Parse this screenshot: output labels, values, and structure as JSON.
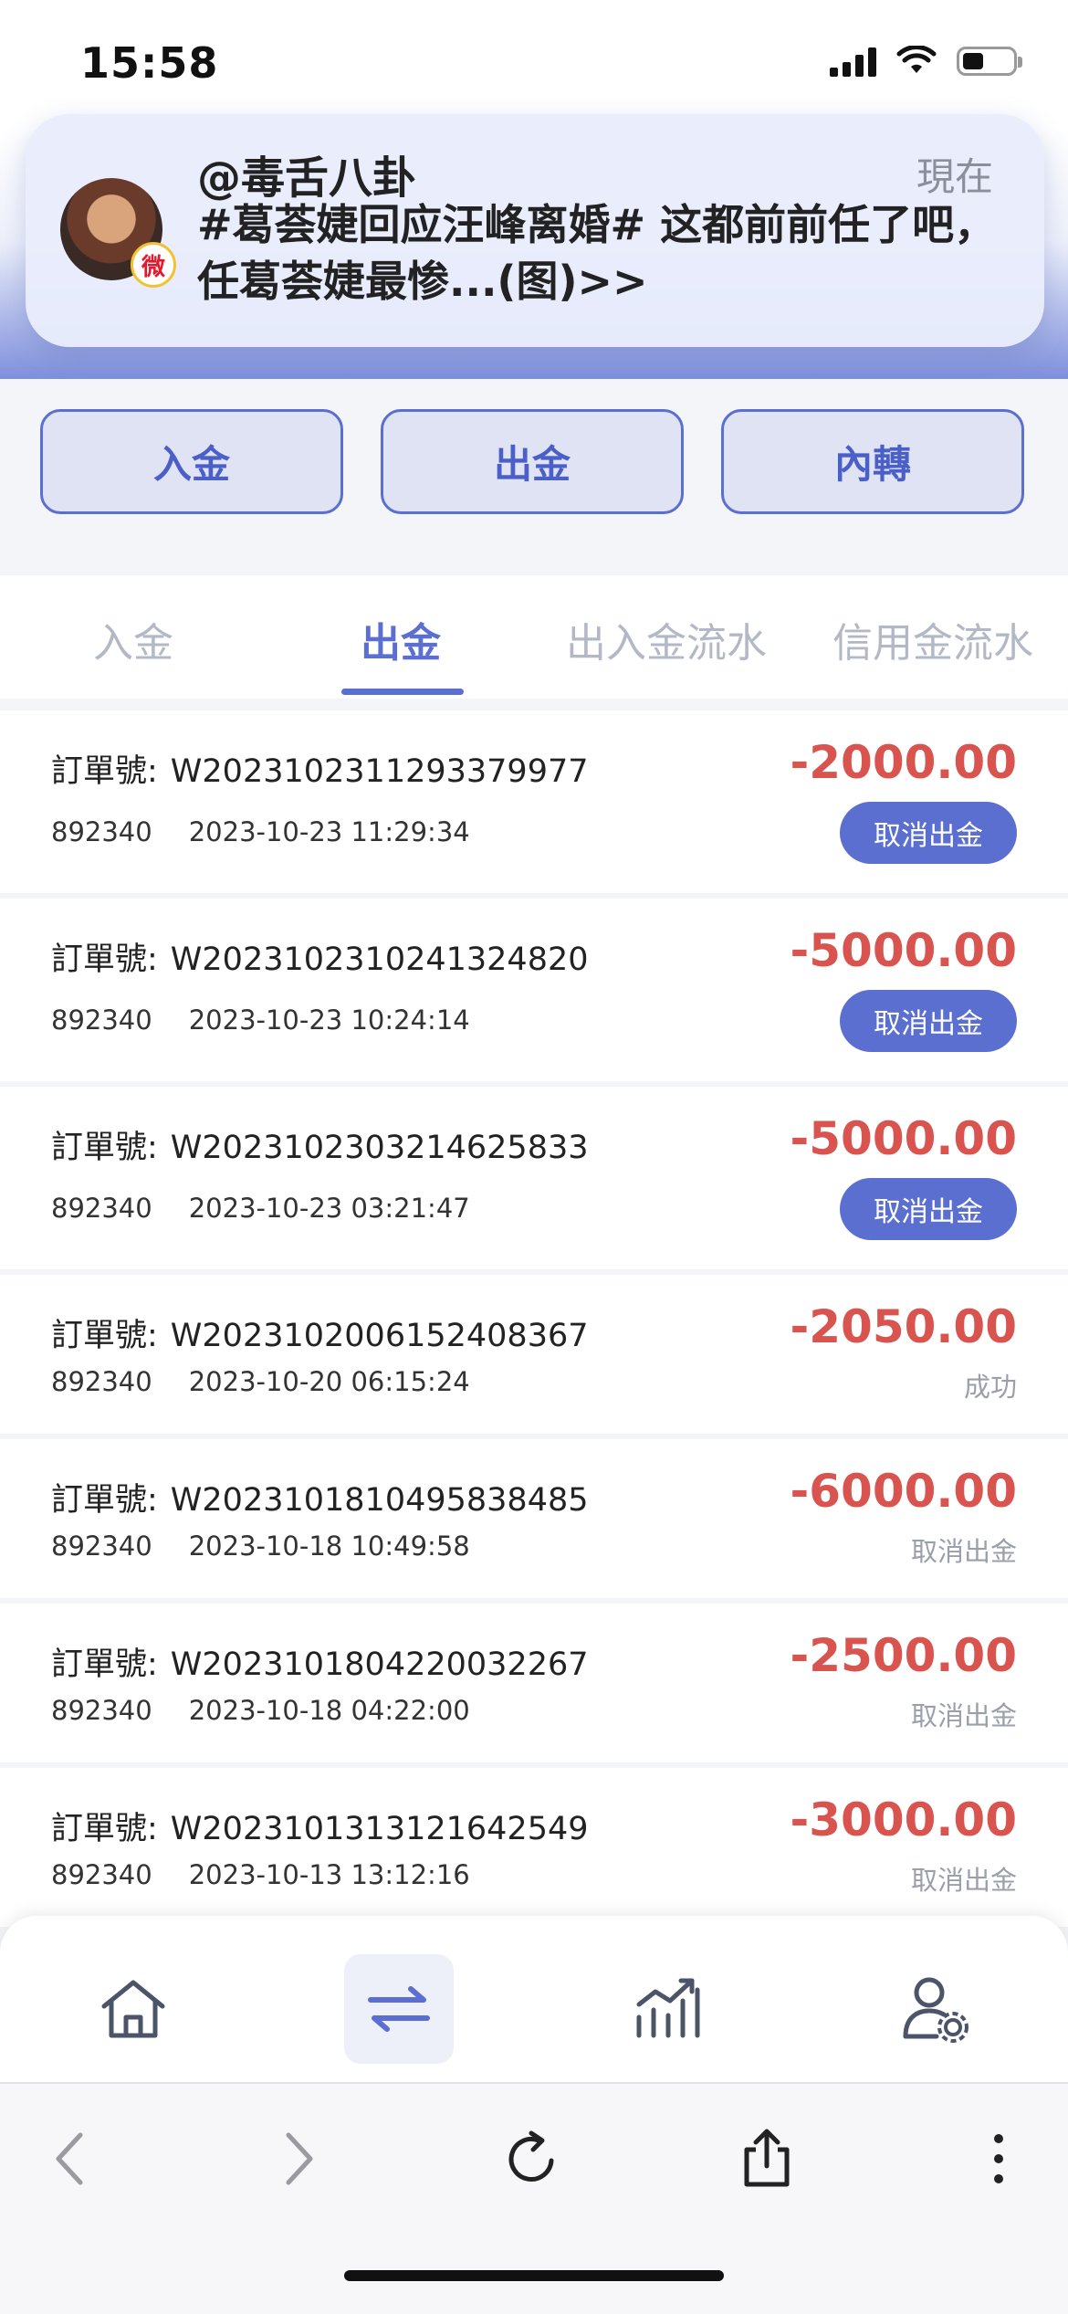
{
  "status_bar": {
    "time": "15:58"
  },
  "notification": {
    "sender": "@毒舌八卦",
    "time": "現在",
    "body": "#葛荟婕回应汪峰离婚# 这都前前任了吧，任葛荟婕最惨...(图)>>",
    "app_icon": "weibo-icon"
  },
  "actions": {
    "deposit": "入金",
    "withdraw": "出金",
    "transfer": "內轉"
  },
  "tabs": [
    {
      "label": "入金",
      "active": false
    },
    {
      "label": "出金",
      "active": true
    },
    {
      "label": "出入金流水",
      "active": false
    },
    {
      "label": "信用金流水",
      "active": false
    }
  ],
  "order_prefix": "訂單號:",
  "records": [
    {
      "order_no": "W20231023112933​79977",
      "account": "892340",
      "datetime": "2023-10-23 11:29:34",
      "amount": "-2000.00",
      "status": "",
      "cancel_label": "取消出金",
      "cancelable": true
    },
    {
      "order_no": "W20231023102413​24820",
      "account": "892340",
      "datetime": "2023-10-23 10:24:14",
      "amount": "-5000.00",
      "status": "",
      "cancel_label": "取消出金",
      "cancelable": true
    },
    {
      "order_no": "W20231023032146​25833",
      "account": "892340",
      "datetime": "2023-10-23 03:21:47",
      "amount": "-5000.00",
      "status": "",
      "cancel_label": "取消出金",
      "cancelable": true
    },
    {
      "order_no": "W20231020061524​08367",
      "account": "892340",
      "datetime": "2023-10-20 06:15:24",
      "amount": "-2050.00",
      "status": "成功",
      "cancelable": false
    },
    {
      "order_no": "W20231018104958​38485",
      "account": "892340",
      "datetime": "2023-10-18 10:49:58",
      "amount": "-6000.00",
      "status": "取消出金",
      "cancelable": false
    },
    {
      "order_no": "W20231018042200​32267",
      "account": "892340",
      "datetime": "2023-10-18 04:22:00",
      "amount": "-2500.00",
      "status": "取消出金",
      "cancelable": false
    },
    {
      "order_no": "W20231013131216​42549",
      "account": "892340",
      "datetime": "2023-10-13 13:12:16",
      "amount": "-3000.00",
      "status": "取消出金",
      "cancelable": false
    }
  ],
  "bottom_nav": [
    "home-icon",
    "transfer-icon",
    "chart-icon",
    "user-settings-icon"
  ],
  "colors": {
    "accent": "#5b6fd0",
    "negative": "#d9534f",
    "muted": "#9aa0ab"
  }
}
